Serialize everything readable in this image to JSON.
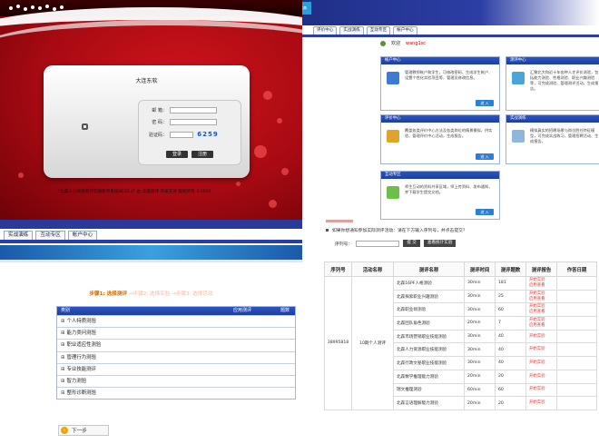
{
  "login": {
    "logo_text": "",
    "panel_title": "大连东软",
    "fields": [
      {
        "label": "邮 箱：",
        "value": ""
      },
      {
        "label": "密 码：",
        "value": ""
      },
      {
        "label": "验证码：",
        "value": ""
      }
    ],
    "captcha": "6259",
    "login_button": "登录",
    "register_button": "注册",
    "footer": "\"北森人力资源测评实践教学系统NES5.0\" 由 北森测评 开发支持 版权所有 ©2010"
  },
  "dashboard": {
    "brand": "Be",
    "brand_badge": "北森",
    "tabs": [
      "评价中心",
      "实战演练",
      "互动专区",
      "帐户中心"
    ],
    "welcome_prefix": "欢迎",
    "welcome_user": "wang1sc",
    "cards": [
      {
        "title": "帐户中心",
        "text": "管理教师帐户和学生，可修改密码、生成学生帐户、设置个性化实验项目等，管理员修改信息。",
        "button": "进 入"
      },
      {
        "title": "测评中心",
        "text": "汇聚北大和近十年各种人才评价测验，包括能力测验、性格测验、职业兴趣测验等，可完成测验、管理测评活动，生成报告。",
        "button": "进 入"
      },
      {
        "title": "评价中心",
        "text": "覆盖各类评价中心方法及各类岗位的情景模拟，供实验、管理评价中心活动，生成报告。",
        "button": "进 入"
      },
      {
        "title": "实战演练",
        "text": "模拟真实的招聘场景与岗位胜任特征模型，可完成实战练习，管理招聘活动、生成报告。",
        "button": "进 入"
      },
      {
        "title": "互动专区",
        "text": "师生互动的资料共享区域，师上传资料、发布通知，并下载学生提交文档。",
        "button": "进 入"
      }
    ]
  },
  "wizard": {
    "tabs": [
      "实战演练",
      "互动专区",
      "帐户中心"
    ],
    "steps": {
      "current": "步骤1: 选择测评",
      "rest": " →步骤2: 选择实验 →步骤3: 选择活动"
    },
    "header": {
      "category": "类别",
      "apply": "应用测评",
      "count": "题数"
    },
    "categories": [
      "个人特质测验",
      "能力类问测验",
      "职业适应性测验",
      "管理行为测验",
      "专业技能测评",
      "智力测验",
      "整形诊断测验"
    ],
    "next_button": "下一步"
  },
  "results": {
    "note": "如果你想通知参加实际测评活动：请在下方输入序列号，并点击提交？",
    "serial_label": "序列号：",
    "serial_value": "",
    "submit_button": "提 交",
    "view_button": "查看统计实验",
    "columns": [
      "序列号",
      "活动名称",
      "测评名称",
      "测评时间",
      "测评题数",
      "测评报告",
      "作答日期"
    ],
    "serial": "38995818",
    "activity": "10期个人测评",
    "rows": [
      {
        "name": "北森16PF人格测验",
        "time": "30min",
        "count": "181",
        "report": [
          "开始实验",
          "启用查看"
        ]
      },
      {
        "name": "北森探索职业兴趣测验",
        "time": "30min",
        "count": "25",
        "report": [
          "开始实验",
          "启用查看"
        ]
      },
      {
        "name": "北森职业倾测验",
        "time": "30min",
        "count": "60",
        "report": [
          "开始实验",
          "启用查看"
        ]
      },
      {
        "name": "北森团队角色测验",
        "time": "20min",
        "count": "7",
        "report": [
          "开始实验",
          "启用查看"
        ]
      },
      {
        "name": "北森市场营销职业技能测验",
        "time": "30min",
        "count": "40",
        "report": [
          "开始实验"
        ]
      },
      {
        "name": "北森人力资源职业技能测验",
        "time": "30min",
        "count": "40",
        "report": [
          "开始实验"
        ]
      },
      {
        "name": "北森行政文秘职业技能测验",
        "time": "30min",
        "count": "40",
        "report": [
          "开始实验"
        ]
      },
      {
        "name": "北森数学推理能力测验",
        "time": "20min",
        "count": "20",
        "report": [
          "开始实验"
        ]
      },
      {
        "name": "瑞文推理测验",
        "time": "60min",
        "count": "60",
        "report": [
          "开始实验"
        ]
      },
      {
        "name": "北森言语理解能力测验",
        "time": "20min",
        "count": "20",
        "report": [
          "开始实验"
        ]
      }
    ]
  }
}
